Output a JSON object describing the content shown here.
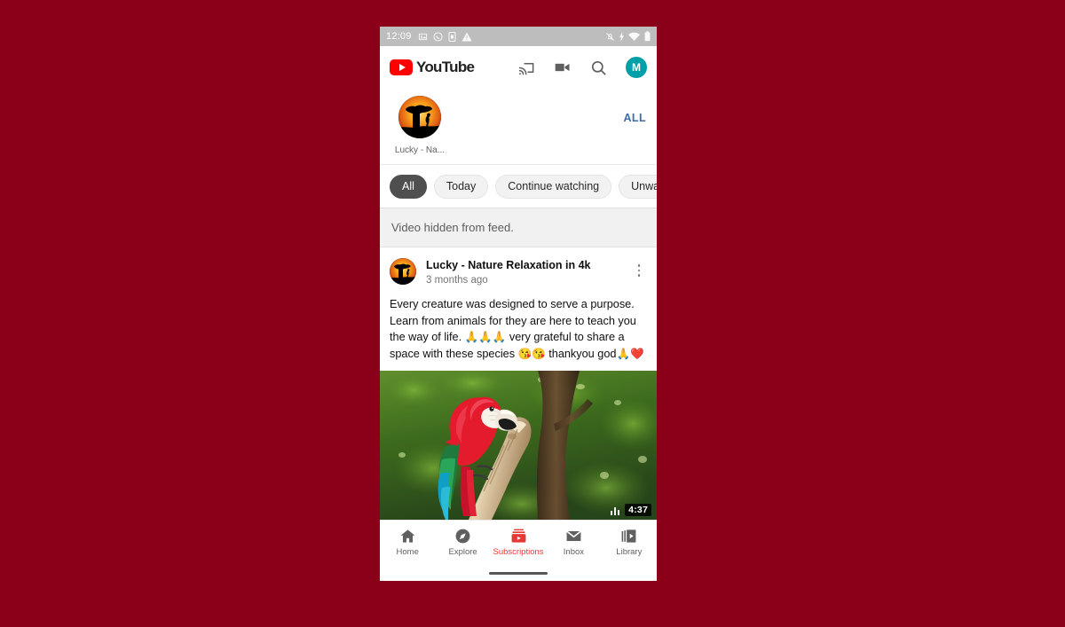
{
  "background_color": "#8b0018",
  "status_bar": {
    "time": "12:09",
    "left_icons": [
      "screenshot-icon",
      "whatsapp-icon",
      "sim-card-icon",
      "warning-icon"
    ],
    "right_icons": [
      "ringer-muted-icon",
      "charging-icon",
      "wifi-icon",
      "battery-icon"
    ]
  },
  "app_bar": {
    "logo_text": "YouTube",
    "actions": [
      "cast-icon",
      "video-camera-icon",
      "search-icon",
      "account-avatar"
    ],
    "account_initial": "M"
  },
  "channel_strip": {
    "channels": [
      {
        "name": "Lucky - Na...",
        "avatar": "savanna-sunset-avatar"
      }
    ],
    "all_label": "ALL",
    "all_color": "#3f6ba8"
  },
  "filter_chips": {
    "selected": "All",
    "items": [
      {
        "label": "All",
        "selected": true
      },
      {
        "label": "Today",
        "selected": false
      },
      {
        "label": "Continue watching",
        "selected": false
      },
      {
        "label": "Unwatched",
        "selected": false
      }
    ]
  },
  "hidden_banner": {
    "text": "Video hidden from feed."
  },
  "post": {
    "channel_name": "Lucky - Nature Relaxation in 4k",
    "timestamp": "3 months ago",
    "menu_icon": "more-vertical-icon",
    "body_part1": "Every creature was designed to serve a purpose. Learn from animals for they are here to teach you the way of life. ",
    "body_emoji1": "🙏🙏🙏",
    "body_part2": " very grateful to share a space with these species ",
    "body_emoji2": "😘😘",
    "body_part3": " thankyou god",
    "body_emoji3": "🙏❤️"
  },
  "thumbnail": {
    "description": "scarlet-macaw-on-branch",
    "duration": "4:37",
    "audio_indicator": "equalizer-icon"
  },
  "bottom_nav": {
    "active": "Subscriptions",
    "active_color": "#e53935",
    "items": [
      {
        "label": "Home",
        "icon": "home-icon",
        "active": false
      },
      {
        "label": "Explore",
        "icon": "compass-icon",
        "active": false
      },
      {
        "label": "Subscriptions",
        "icon": "subscriptions-icon",
        "active": true
      },
      {
        "label": "Inbox",
        "icon": "envelope-icon",
        "active": false
      },
      {
        "label": "Library",
        "icon": "library-icon",
        "active": false
      }
    ]
  }
}
